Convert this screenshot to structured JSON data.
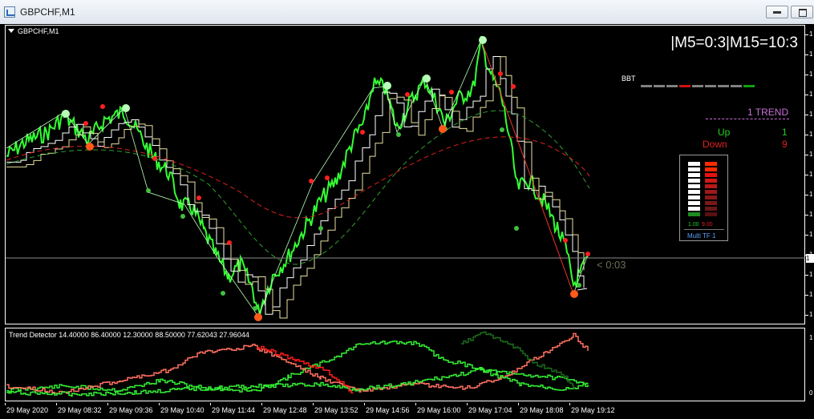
{
  "window": {
    "title": "GBPCHF,M1",
    "icon": "chart-window-icon",
    "buttons": [
      "minimize-icon",
      "maximize-icon"
    ]
  },
  "chart": {
    "symbol_label": "GBPCHF,M1",
    "mtf_status": "|M5=0:3|M15=10:3",
    "bbt": {
      "label": "BBT",
      "dash_colors": [
        "#808080",
        "#808080",
        "#808080",
        "#d01010",
        "#808080",
        "#808080",
        "#808080",
        "#808080",
        "#10a010"
      ]
    },
    "trend_panel": {
      "title": "1 TREND",
      "up_label": "Up",
      "up_value": "1",
      "down_label": "Down",
      "down_value": "9"
    },
    "heatmap": {
      "left_colors": [
        "#ffffff",
        "#ffffff",
        "#ffffff",
        "#ffffff",
        "#ffffff",
        "#ffffff",
        "#ffffff",
        "#ffffff",
        "#ffffff",
        "#1e8c1e"
      ],
      "right_colors": [
        "#ff2a00",
        "#ff2a00",
        "#e81010",
        "#d01818",
        "#b81818",
        "#a01818",
        "#8a1818",
        "#7a1818",
        "#6a1818",
        "#5a1010"
      ],
      "value_left": "1.00",
      "value_right": "9.00",
      "footer": "Multi TF 1"
    },
    "countdown": "< 0:03",
    "price_marker": "1",
    "right_axis_marks": [
      "1",
      "1",
      "1",
      "1",
      "1",
      "1",
      "1",
      "1",
      "1",
      "1",
      "1",
      "1",
      "1",
      "1",
      "1"
    ],
    "colors": {
      "background": "#000000",
      "price_line": "#33ff33",
      "step_white": "#ffffff",
      "step_yellow": "#e8e0a0",
      "ma_red": "#e02020",
      "ma_green": "#2fa02f",
      "fractal_dot": "#ff2020",
      "green_dot": "#40c040"
    }
  },
  "subwindow": {
    "label": "Trend Detector 14.40000 86.40000 12.30000 88.50000 77.62043 27.96044",
    "axis_marks": [
      "1",
      "0"
    ],
    "colors": {
      "green": "#33ee33",
      "salmon": "#ff7060",
      "red": "#ff1a1a",
      "dark_green": "#1a6a1a"
    }
  },
  "time_axis": {
    "labels": [
      "29 May 2020",
      "29 May 08:32",
      "29 May 09:36",
      "29 May 10:40",
      "29 May 11:44",
      "29 May 12:48",
      "29 May 13:52",
      "29 May 14:56",
      "29 May 16:00",
      "29 May 17:04",
      "29 May 18:08",
      "29 May 19:12"
    ]
  }
}
